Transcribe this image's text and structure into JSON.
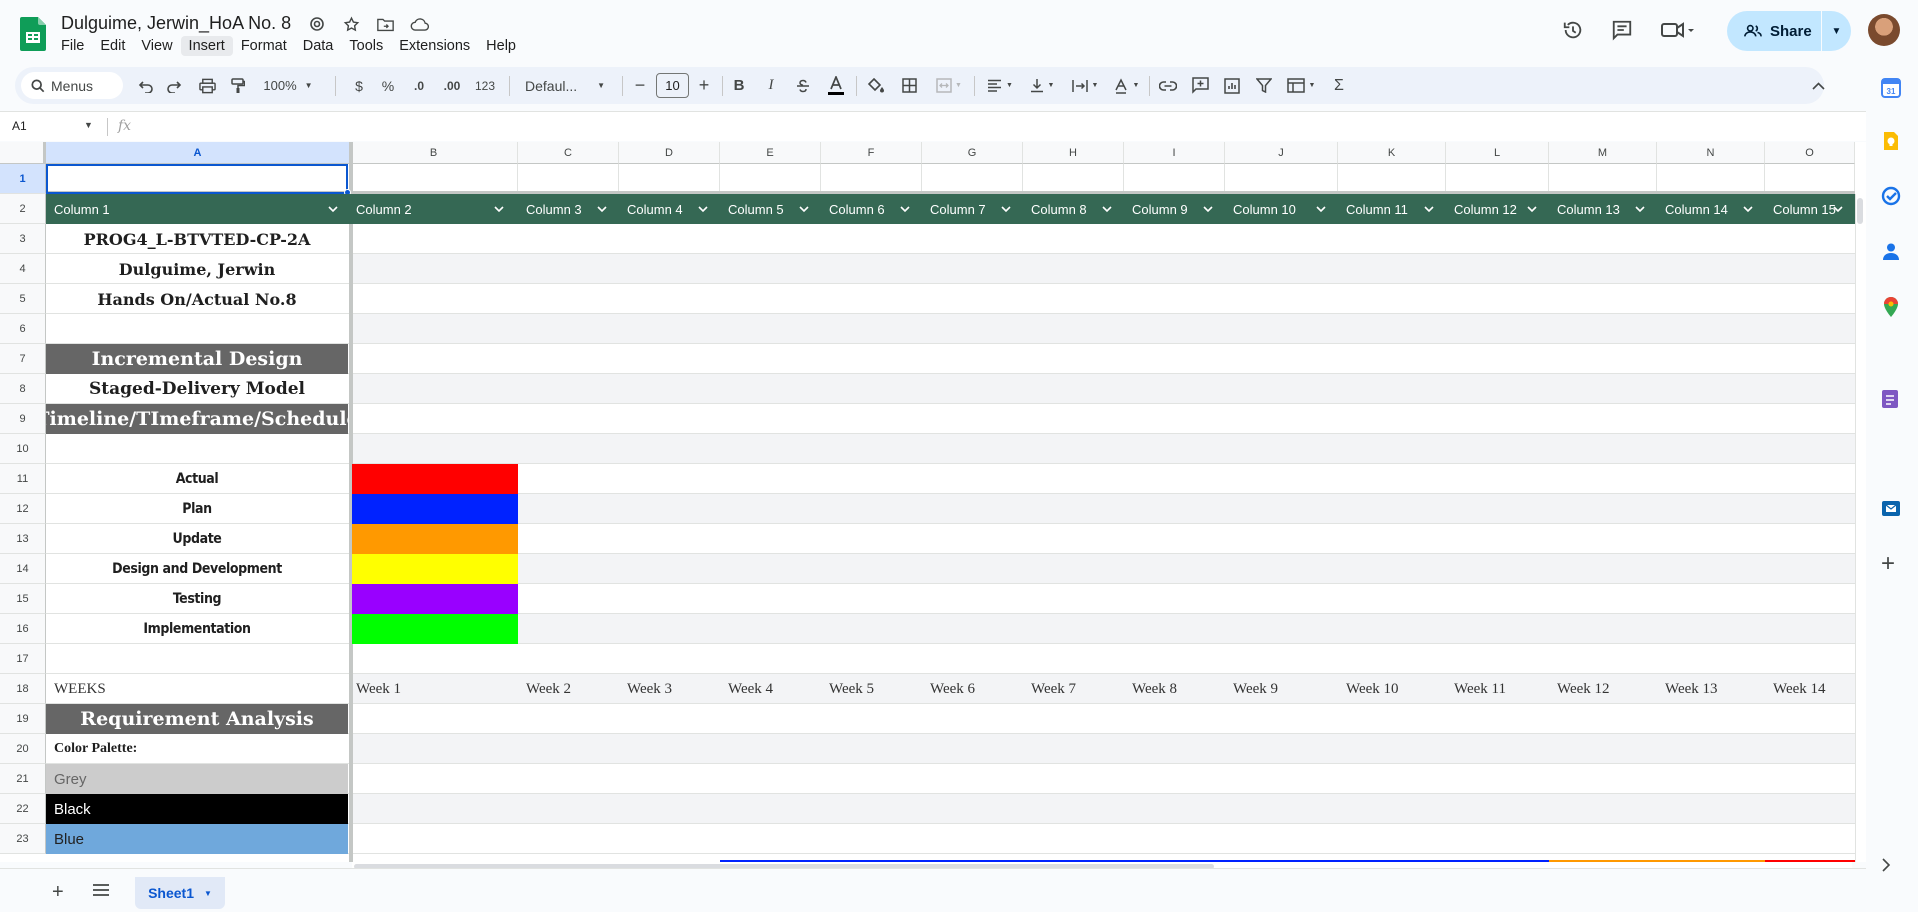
{
  "app": {
    "doc_title": "Dulguime, Jerwin_HoA No. 8",
    "share_label": "Share",
    "colors": {
      "brand_green": "#0f9d58",
      "accent_blue": "#0b57d0",
      "table_header": "#356854",
      "share_bg": "#c2e7ff"
    }
  },
  "menu": [
    "File",
    "Edit",
    "View",
    "Insert",
    "Format",
    "Data",
    "Tools",
    "Extensions",
    "Help"
  ],
  "toolbar": {
    "search_label": "Menus",
    "zoom": "100%",
    "currency": "$",
    "percent": "%",
    "decrease_decimal": ".0",
    "increase_decimal": ".00",
    "number_format": "123",
    "font": "Defaul...",
    "font_size": "10",
    "bold": "B",
    "italic": "I",
    "sum": "Σ"
  },
  "formula_bar": {
    "cell_ref": "A1",
    "fx": "fx",
    "value": ""
  },
  "columns": [
    "A",
    "B",
    "C",
    "D",
    "E",
    "F",
    "G",
    "H",
    "I",
    "J",
    "K",
    "L",
    "M",
    "N",
    "O"
  ],
  "rows": [
    "1",
    "2",
    "3",
    "4",
    "5",
    "6",
    "7",
    "8",
    "9",
    "10",
    "11",
    "12",
    "13",
    "14",
    "15",
    "16",
    "17",
    "18",
    "19",
    "20",
    "21",
    "22",
    "23"
  ],
  "table_header": [
    "Column 1",
    "Column 2",
    "Column 3",
    "Column 4",
    "Column 5",
    "Column 6",
    "Column 7",
    "Column 8",
    "Column 9",
    "Column 10",
    "Column 11",
    "Column 12",
    "Column 13",
    "Column 14",
    "Column 15"
  ],
  "cells": {
    "a3": "PROG4_L-BTVTED-CP-2A",
    "a4": "Dulguime, Jerwin",
    "a5": "Hands On/Actual No.8",
    "a7": "Incremental Design",
    "a8": "Staged-Delivery Model",
    "a9": "Timeline/TImeframe/Schedule",
    "a18": "WEEKS",
    "a19": "Requirement Analysis",
    "a20": "Color Palette:",
    "a21": "Grey",
    "a22": "Black",
    "a23": "Blue"
  },
  "legend": [
    {
      "label": "Actual",
      "color": "#ff0000"
    },
    {
      "label": "Plan",
      "color": "#0022ff"
    },
    {
      "label": "Update",
      "color": "#ff9900"
    },
    {
      "label": "Design and Development",
      "color": "#ffff00"
    },
    {
      "label": "Testing",
      "color": "#9900ff"
    },
    {
      "label": "Implementation",
      "color": "#00ff00"
    }
  ],
  "weeks": [
    "Week 1",
    "Week 2",
    "Week 3",
    "Week 4",
    "Week 5",
    "Week 6",
    "Week 7",
    "Week 8",
    "Week 9",
    "Week 10",
    "Week 11",
    "Week 12",
    "Week 13",
    "Week 14"
  ],
  "sheet": {
    "tab": "Sheet1"
  }
}
